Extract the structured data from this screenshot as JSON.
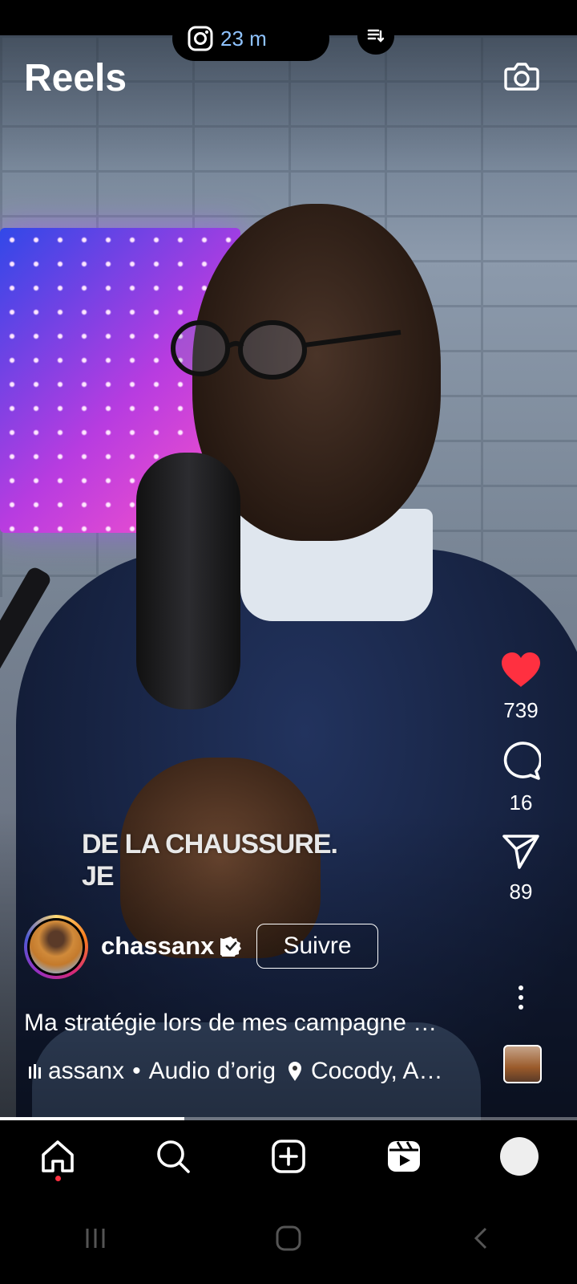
{
  "status": {
    "time_label": "23 m",
    "app_icon": "instagram-icon"
  },
  "header": {
    "title": "Reels",
    "camera_icon": "camera-icon"
  },
  "video": {
    "subtitle_line1": "DE LA CHAUSSURE.",
    "subtitle_line2": "JE"
  },
  "actions": {
    "like": {
      "icon": "heart-icon",
      "count": "739",
      "color": "#ff3040",
      "liked": true
    },
    "comment": {
      "icon": "comment-icon",
      "count": "16"
    },
    "share": {
      "icon": "send-icon",
      "count": "89"
    },
    "more": {
      "icon": "more-icon"
    }
  },
  "author": {
    "username": "chassanx",
    "verified": true,
    "follow_label": "Suivre"
  },
  "caption": "Ma stratégie lors de mes campagne …",
  "audio": {
    "artist": "assanx",
    "separator": "•",
    "track": "Audio d’orig",
    "location": "Cocody, A…"
  },
  "playback": {
    "progress": 0.32
  },
  "nav": {
    "items": [
      "home-icon",
      "search-icon",
      "create-icon",
      "reels-icon",
      "profile-avatar"
    ],
    "active": "home-icon"
  },
  "colors": {
    "accent_red": "#ff3040",
    "nav_bg": "#000000",
    "time_text": "#8fc3ff"
  }
}
